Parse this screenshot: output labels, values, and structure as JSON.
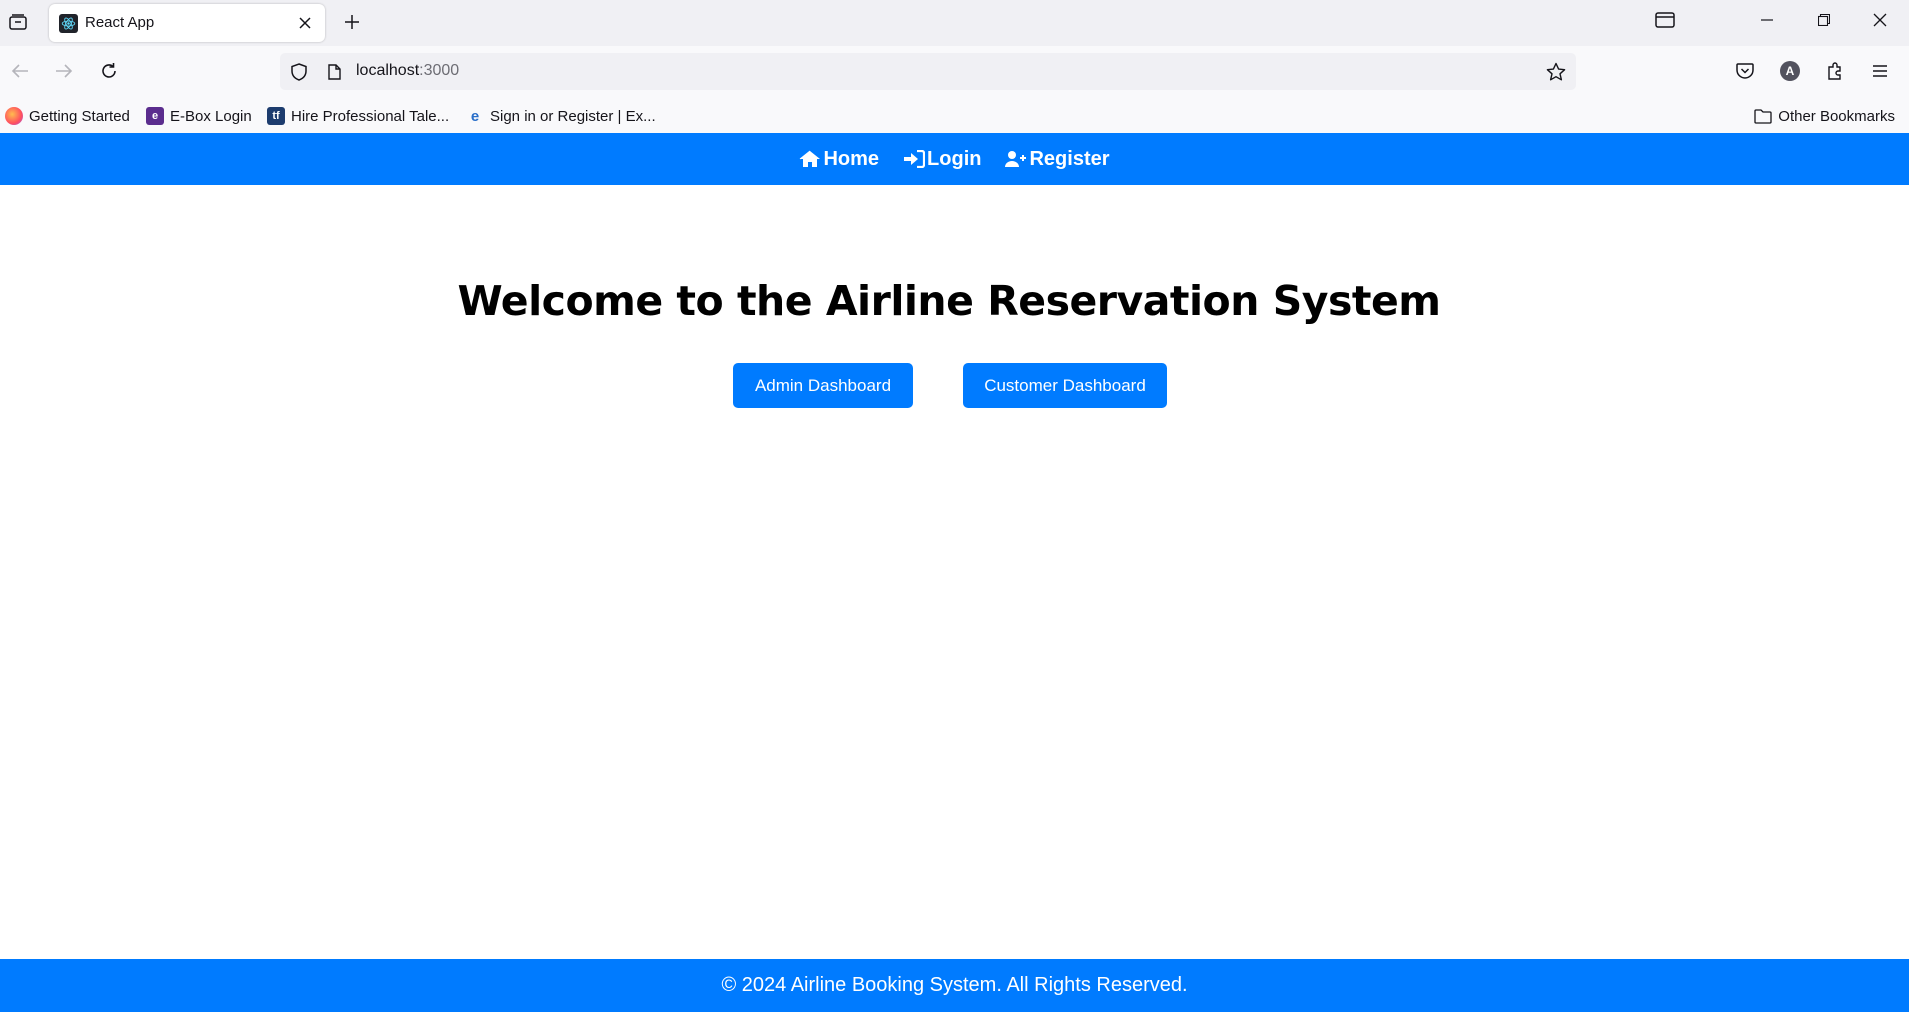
{
  "browser": {
    "tab": {
      "title": "React App",
      "favicon": "react-icon"
    },
    "url": {
      "host": "localhost",
      "port": ":3000"
    },
    "bookmarks": [
      {
        "label": "Getting Started",
        "icon": "firefox-icon"
      },
      {
        "label": "E-Box Login",
        "icon": "ebox-icon"
      },
      {
        "label": "Hire Professional Tale...",
        "icon": "tf-icon"
      },
      {
        "label": "Sign in or Register | Ex...",
        "icon": "ex-icon"
      }
    ],
    "other_bookmarks": "Other Bookmarks",
    "profile_initial": "A"
  },
  "app": {
    "nav": [
      {
        "label": "Home",
        "icon": "home-icon"
      },
      {
        "label": "Login",
        "icon": "login-icon"
      },
      {
        "label": "Register",
        "icon": "user-plus-icon"
      }
    ],
    "title": "Welcome to the Airline Reservation System",
    "buttons": {
      "admin": "Admin Dashboard",
      "customer": "Customer Dashboard"
    },
    "footer": "© 2024 Airline Booking System. All Rights Reserved."
  },
  "colors": {
    "primary": "#007bff",
    "tabbar": "#f0f0f4",
    "toolbar": "#f9f9fb"
  }
}
